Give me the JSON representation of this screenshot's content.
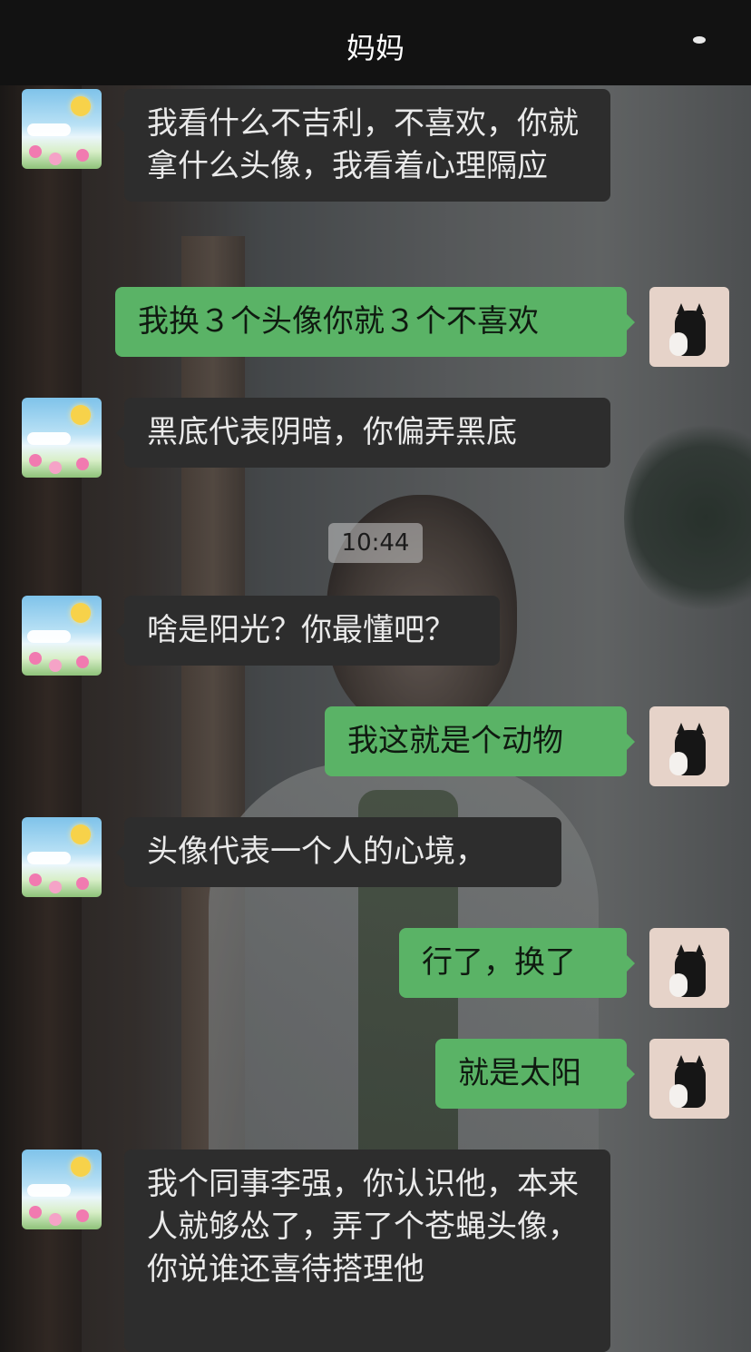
{
  "header": {
    "title": "妈妈",
    "more_icon": "more-icon"
  },
  "messages": [
    {
      "sender": "mom",
      "text": "我看什么不吉利，不喜欢，你就拿什么头像，我看着心理隔应"
    },
    {
      "sender": "me",
      "text": "我换３个头像你就３个不喜欢"
    },
    {
      "sender": "mom",
      "text": "黑底代表阴暗，你偏弄黑底"
    },
    {
      "sender": "time",
      "text": "10:44"
    },
    {
      "sender": "mom",
      "text": "啥是阳光？你最懂吧？"
    },
    {
      "sender": "me",
      "text": "我这就是个动物"
    },
    {
      "sender": "mom",
      "text": "头像代表一个人的心境，"
    },
    {
      "sender": "me",
      "text": "行了，换了"
    },
    {
      "sender": "me",
      "text": "就是太阳"
    },
    {
      "sender": "mom",
      "text": "我个同事李强，你认识他，本来人就够怂了，弄了个苍蝇头像，你说谁还喜待搭理他"
    }
  ],
  "colors": {
    "my_bubble": "#5ab366",
    "their_bubble": "#2d2d2d",
    "topbar": "#121212"
  }
}
